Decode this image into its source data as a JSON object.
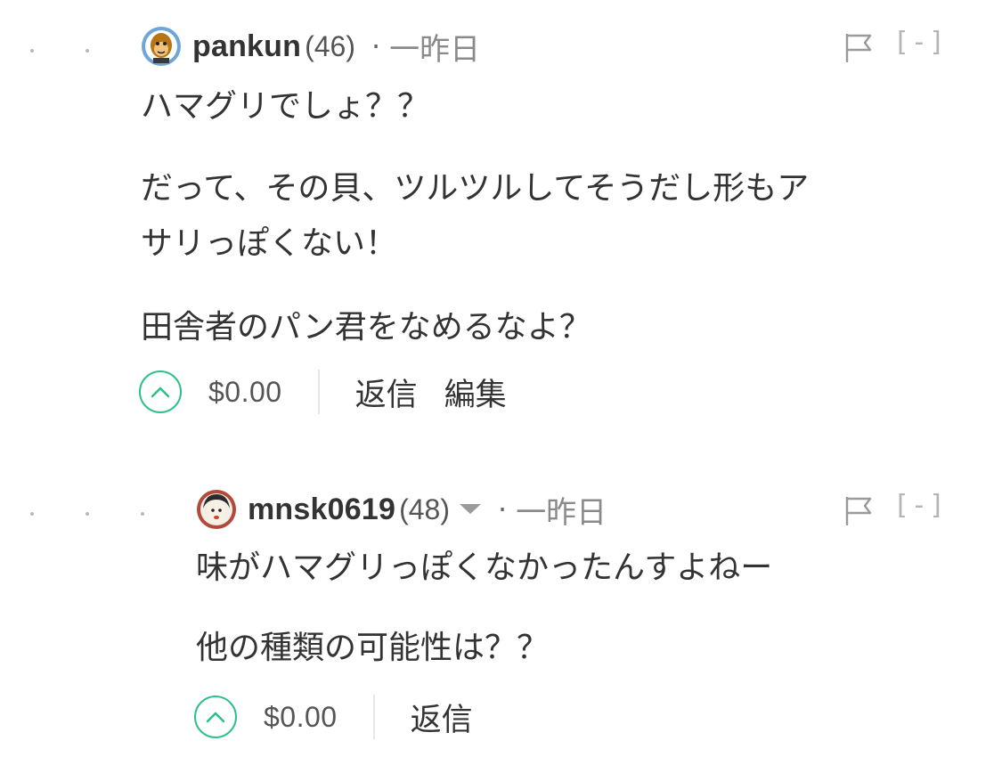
{
  "comments": [
    {
      "author": "pankun",
      "reputation": "(46)",
      "separator": "·",
      "time": "一昨日",
      "collapse": "[-]",
      "paragraphs": [
        "ハマグリでしょ？？",
        "だって、その貝、ツルツルしてそうだし形もア",
        "サリっぽくない！",
        "田舎者のパン君をなめるなよ？"
      ],
      "payout": "$0.00",
      "actions": [
        "返信",
        "編集"
      ],
      "avatar_icon": "monkey-avatar-icon"
    },
    {
      "author": "mnsk0619",
      "reputation": "(48)",
      "separator": "·",
      "time": "一昨日",
      "collapse": "[-]",
      "paragraphs": [
        "味がハマグリっぽくなかったんすよねー",
        "他の種類の可能性は？？"
      ],
      "payout": "$0.00",
      "actions": [
        "返信"
      ],
      "avatar_icon": "person-avatar-icon"
    }
  ],
  "colors": {
    "vote_accent": "#2fc08a",
    "text": "#333333",
    "muted": "#8a8a8a"
  }
}
